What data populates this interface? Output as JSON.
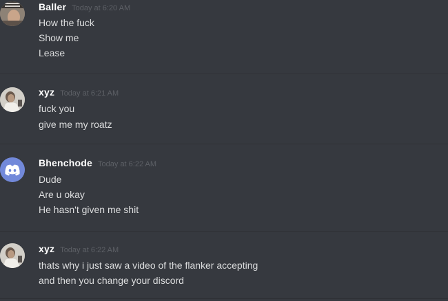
{
  "messages": [
    {
      "username": "Baller",
      "timestamp": "Today at 6:20 AM",
      "avatar_icon": "meme-photo-avatar",
      "lines": [
        "How the fuck",
        "Show me",
        "Lease"
      ]
    },
    {
      "username": "xyz",
      "timestamp": "Today at 6:21 AM",
      "avatar_icon": "person-photo-avatar",
      "lines": [
        "fuck you",
        "give me my roatz"
      ]
    },
    {
      "username": "Bhenchode",
      "timestamp": "Today at 6:22 AM",
      "avatar_icon": "discord-logo-icon",
      "lines": [
        "Dude",
        "Are u okay",
        "He hasn't given me shit"
      ]
    },
    {
      "username": "xyz",
      "timestamp": "Today at 6:22 AM",
      "avatar_icon": "person-photo-avatar",
      "lines": [
        "thats why i just saw a video of the flanker accepting",
        "and then you change your discord"
      ]
    }
  ],
  "colors": {
    "background": "#36393f",
    "divider": "#2f3136",
    "username": "#ffffff",
    "message_text": "#dcddde",
    "timestamp": "#5d6066",
    "discord_blurple": "#7289da"
  }
}
